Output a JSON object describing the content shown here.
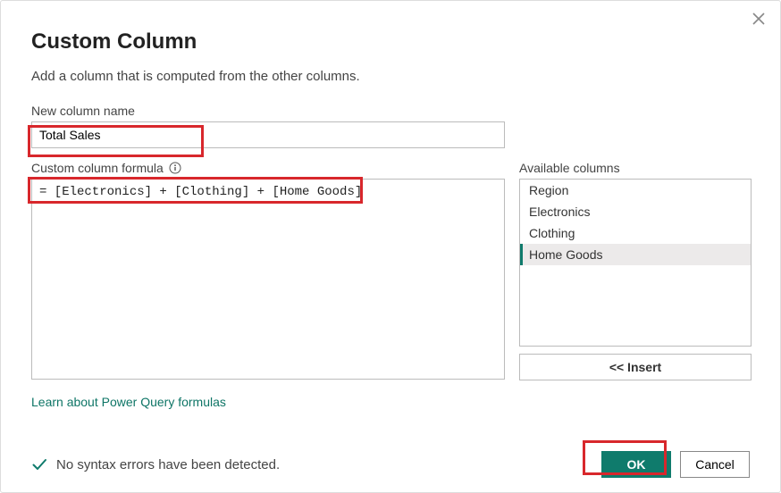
{
  "dialog": {
    "title": "Custom Column",
    "subtitle": "Add a column that is computed from the other columns."
  },
  "new_column": {
    "label": "New column name",
    "value": "Total Sales"
  },
  "formula": {
    "label": "Custom column formula",
    "value": "= [Electronics] + [Clothing] + [Home Goods]"
  },
  "available": {
    "label": "Available columns",
    "items": [
      {
        "label": "Region",
        "selected": false
      },
      {
        "label": "Electronics",
        "selected": false
      },
      {
        "label": "Clothing",
        "selected": false
      },
      {
        "label": "Home Goods",
        "selected": true
      }
    ],
    "insert_label": "<< Insert"
  },
  "link": {
    "learn": "Learn about Power Query formulas"
  },
  "status": {
    "message": "No syntax errors have been detected."
  },
  "buttons": {
    "ok": "OK",
    "cancel": "Cancel"
  }
}
